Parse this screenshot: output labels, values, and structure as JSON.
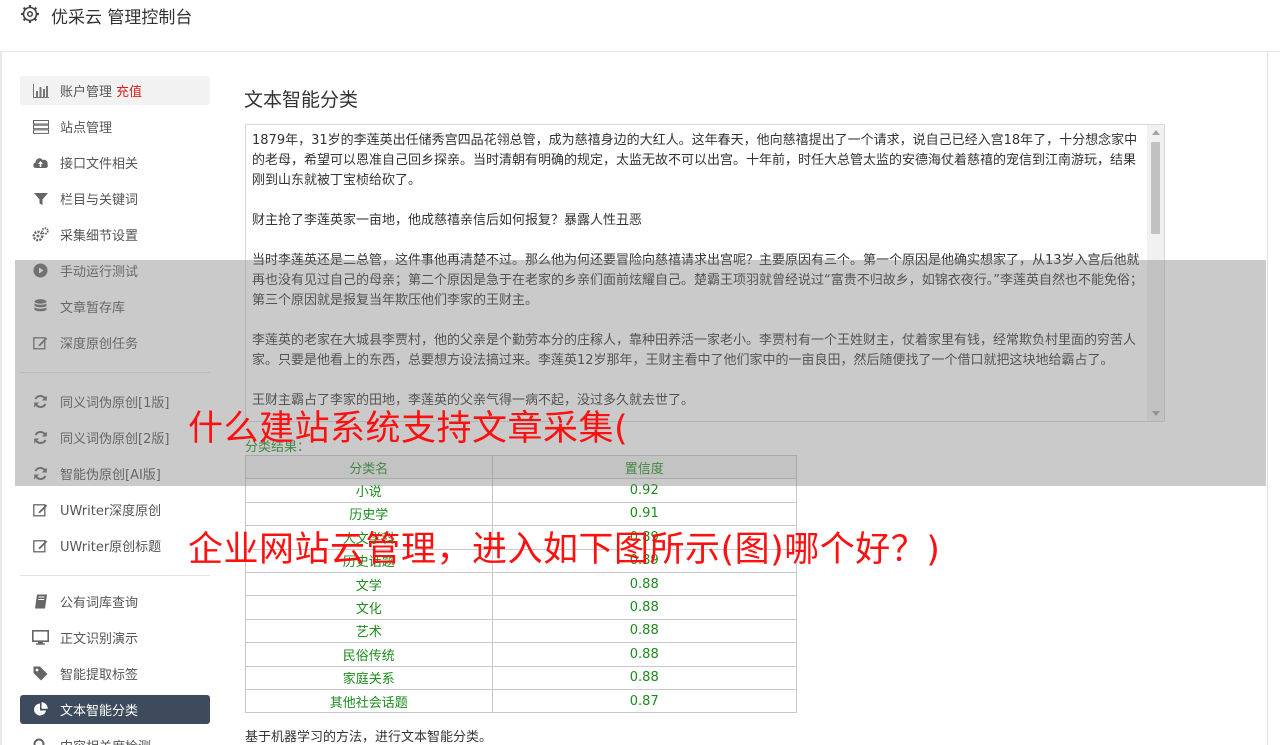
{
  "app": {
    "title": "优采云 管理控制台",
    "icon": "gear-icon"
  },
  "sidebar": {
    "groups": [
      [
        {
          "label": "账户管理",
          "badge": "充值",
          "icon": "bar-chart-icon"
        },
        {
          "label": "站点管理",
          "icon": "server-icon"
        },
        {
          "label": "接口文件相关",
          "icon": "cloud-upload-icon"
        },
        {
          "label": "栏目与关键词",
          "icon": "filter-icon"
        },
        {
          "label": "采集细节设置",
          "icon": "gears-icon"
        },
        {
          "label": "手动运行测试",
          "icon": "play-circle-icon"
        },
        {
          "label": "文章暂存库",
          "icon": "database-icon"
        },
        {
          "label": "深度原创任务",
          "icon": "edit-icon"
        }
      ],
      [
        {
          "label": "同义词伪原创[1版]",
          "icon": "refresh-icon"
        },
        {
          "label": "同义词伪原创[2版]",
          "icon": "refresh-icon"
        },
        {
          "label": "智能伪原创[AI版]",
          "icon": "refresh-icon"
        },
        {
          "label": "UWriter深度原创",
          "icon": "edit-icon"
        },
        {
          "label": "UWriter原创标题",
          "icon": "edit-icon"
        }
      ],
      [
        {
          "label": "公有词库查询",
          "icon": "book-icon"
        },
        {
          "label": "正文识别演示",
          "icon": "monitor-icon"
        },
        {
          "label": "智能提取标签",
          "icon": "tag-icon"
        },
        {
          "label": "文本智能分类",
          "icon": "pie-chart-icon"
        },
        {
          "label": "内容相关度检测",
          "icon": "search-icon"
        }
      ]
    ]
  },
  "main": {
    "title": "文本智能分类",
    "text_paragraphs": [
      "1879年，31岁的李莲英出任储秀宫四品花翎总管，成为慈禧身边的大红人。这年春天，他向慈禧提出了一个请求，说自己已经入宫18年了，十分想念家中的老母，希望可以恩准自己回乡探亲。当时清朝有明确的规定，太监无故不可以出宫。十年前，时任大总管太监的安德海仗着慈禧的宠信到江南游玩，结果刚到山东就被丁宝桢给砍了。",
      "财主抢了李莲英家一亩地，他成慈禧亲信后如何报复？暴露人性丑恶",
      "当时李莲英还是二总管，这件事他再清楚不过。那么他为何还要冒险向慈禧请求出宫呢？主要原因有三个。第一个原因是他确实想家了，从13岁入宫后他就再也没有见过自己的母亲；第二个原因是急于在老家的乡亲们面前炫耀自己。楚霸王项羽就曾经说过“富贵不归故乡，如锦衣夜行。”李莲英自然也不能免俗；第三个原因就是报复当年欺压他们李家的王财主。",
      "李莲英的老家在大城县李贾村，他的父亲是个勤劳本分的庄稼人，靠种田养活一家老小。李贾村有一个王姓财主，仗着家里有钱，经常欺负村里面的穷苦人家。只要是他看上的东西，总要想方设法搞过来。李莲英12岁那年，王财主看中了他们家中的一亩良田，然后随便找了一个借口就把这块地给霸占了。",
      "王财主霸占了李家的田地，李莲英的父亲气得一病不起，没过多久就去世了。"
    ],
    "result_label": "分类结果：",
    "table": {
      "headers": [
        "分类名",
        "置信度"
      ],
      "rows": [
        [
          "小说",
          "0.92"
        ],
        [
          "历史学",
          "0.91"
        ],
        [
          "人文学科",
          "0.89"
        ],
        [
          "历史话题",
          "0.89"
        ],
        [
          "文学",
          "0.88"
        ],
        [
          "文化",
          "0.88"
        ],
        [
          "艺术",
          "0.88"
        ],
        [
          "民俗传统",
          "0.88"
        ],
        [
          "家庭关系",
          "0.88"
        ],
        [
          "其他社会话题",
          "0.87"
        ]
      ]
    },
    "footnote": "基于机器学习的方法，进行文本智能分类。"
  },
  "overlay": {
    "headline_line1": "什么建站系统支持文章采集(",
    "headline_line2": "企业网站云管理，进入如下图所示(图)哪个好？)"
  },
  "colors": {
    "accent_red": "#d9241b",
    "result_green": "#1c8a1c",
    "active_nav": "#3d4b5c",
    "headline_red": "#ff1010"
  }
}
